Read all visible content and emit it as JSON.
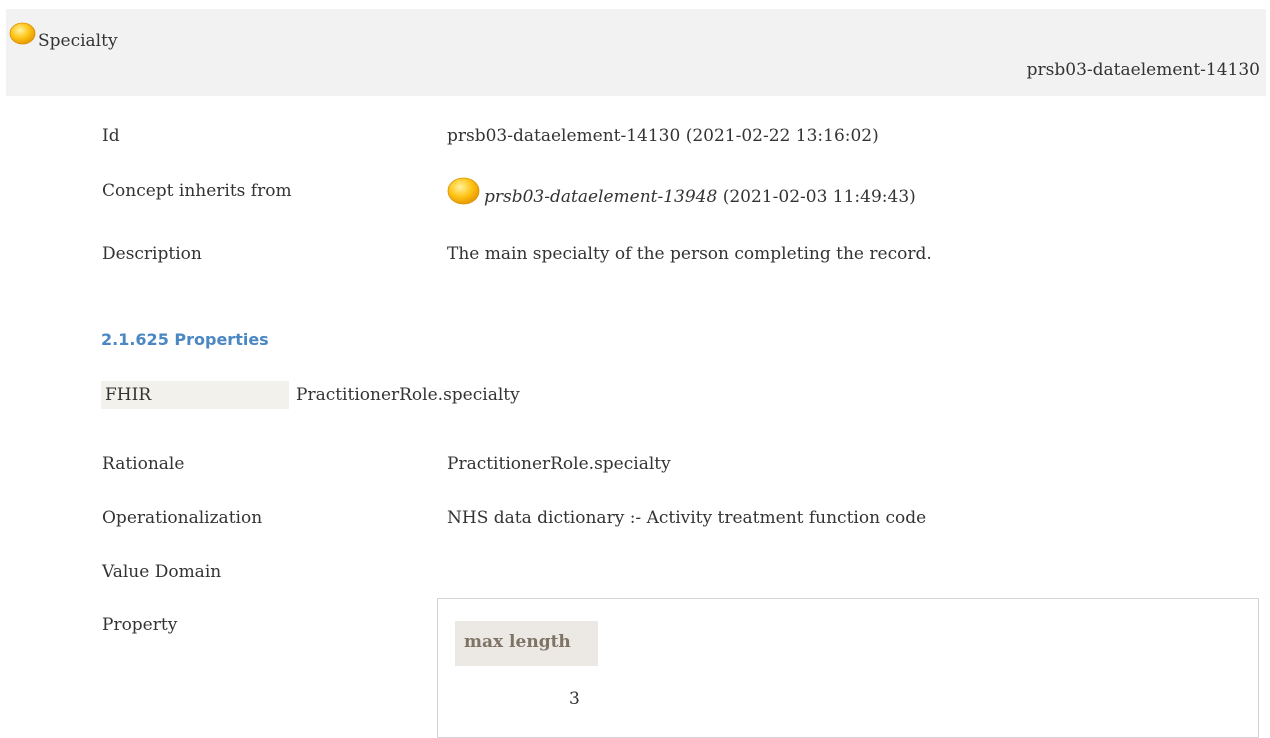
{
  "header": {
    "title": "Specialty",
    "id": "prsb03-dataelement-14130",
    "icon": "concept-ball-icon",
    "icon_color": "#f5b400"
  },
  "details": {
    "id_label": "Id",
    "id_value": "prsb03-dataelement-14130 (2021-02-22 13:16:02)",
    "inherits_label": "Concept inherits from",
    "inherits_ref": "prsb03-dataelement-13948",
    "inherits_date": " (2021-02-03 11:49:43)",
    "description_label": "Description",
    "description_value": "The main specialty of the person completing the record."
  },
  "properties": {
    "heading": "2.1.625 Properties",
    "fhir_label": "FHIR",
    "fhir_value": "PractitionerRole.specialty",
    "rationale_label": "Rationale",
    "rationale_value": "PractitionerRole.specialty",
    "operationalization_label": "Operationalization",
    "operationalization_value": "NHS data dictionary :- Activity treatment function code",
    "value_domain_label": "Value Domain",
    "property_label": "Property",
    "property_table": {
      "header": "max length",
      "value": "3"
    }
  },
  "colors": {
    "heading_blue": "#4a87c3",
    "header_bg": "#f2f2f2",
    "table_header_bg": "#ece9e5"
  }
}
